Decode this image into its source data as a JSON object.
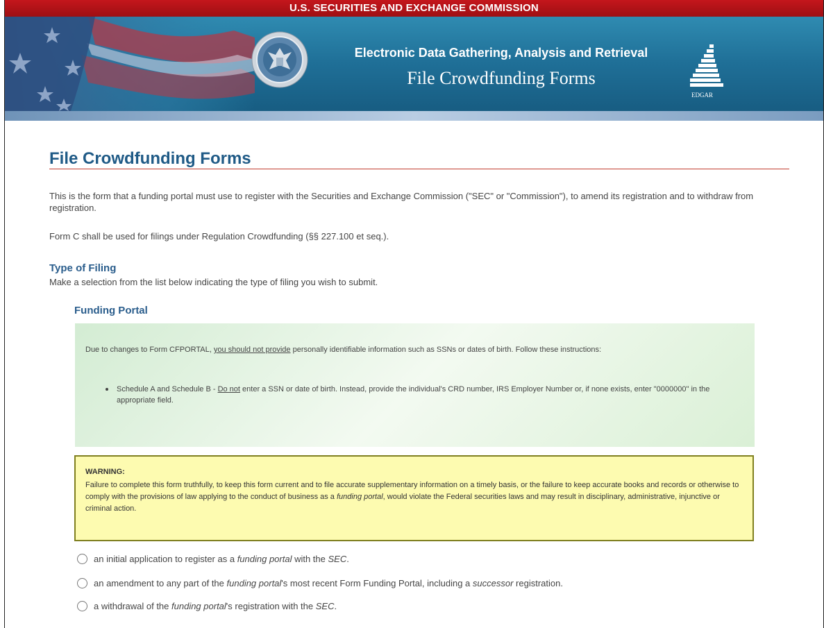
{
  "header": {
    "agency": "U.S. SECURITIES AND EXCHANGE COMMISSION",
    "system_name": "Electronic Data Gathering, Analysis and Retrieval",
    "app_title": "File Crowdfunding Forms",
    "logo_text": "EDGAR",
    "seal_icon": "sec-seal-icon",
    "flag_icon": "us-flag-icon"
  },
  "page": {
    "title": "File Crowdfunding Forms",
    "intro_1": "This is the form that a funding portal must use to register with the Securities and Exchange Commission (\"SEC\" or \"Commission\"), to amend its registration and to withdraw from registration.",
    "intro_2": "Form C shall be used for filings under Regulation Crowdfunding (§§ 227.100 et seq.).",
    "type_heading": "Type of Filing",
    "type_instructions": "Make a selection from the list below indicating the type of filing you wish to submit.",
    "section_heading": "Funding Portal"
  },
  "notice": {
    "intro_pre": "Due to changes to Form CFPORTAL, ",
    "intro_underlined": "you should not provide",
    "intro_post": " personally identifiable information such as SSNs or dates of birth. Follow these instructions:",
    "bullet_pre": "Schedule A and Schedule B - ",
    "bullet_underlined": "Do not",
    "bullet_post": " enter a SSN or date of birth. Instead, provide the individual's CRD number, IRS Employer Number or, if none exists, enter \"0000000\" in the appropriate field."
  },
  "warning": {
    "title": "WARNING:",
    "text_1": "Failure to complete this form truthfully, to keep this form current and to file accurate supplementary information on a timely basis, or the failure to keep accurate books and records or otherwise to comply with the provisions of law applying to the conduct of business as a ",
    "text_italic": "funding portal",
    "text_2": ", would violate the Federal securities laws and may result in disciplinary, administrative, injunctive or criminal action."
  },
  "options": [
    {
      "pre": "an initial application to register as a ",
      "i1": "funding portal",
      "mid": " with the ",
      "i2": "SEC",
      "post": ".",
      "selected": false
    },
    {
      "pre": "an amendment to any part of the ",
      "i1": "funding portal",
      "mid": "'s most recent Form Funding Portal, including a ",
      "i2": "successor",
      "post": " registration.",
      "selected": false
    },
    {
      "pre": "a withdrawal of the ",
      "i1": "funding portal",
      "mid": "'s registration with the ",
      "i2": "SEC",
      "post": ".",
      "selected": false
    }
  ]
}
